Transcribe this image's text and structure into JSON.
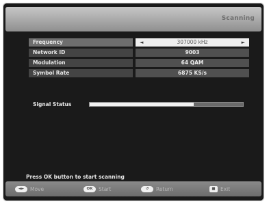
{
  "header": {
    "title": "Scanning"
  },
  "fields": [
    {
      "label": "Frequency",
      "value": "307000 kHz",
      "selected": true
    },
    {
      "label": "Network ID",
      "value": "9003",
      "selected": false
    },
    {
      "label": "Modulation",
      "value": "64 QAM",
      "selected": false
    },
    {
      "label": "Symbol Rate",
      "value": "6875 KS/s",
      "selected": false
    }
  ],
  "signal": {
    "label": "Signal Status",
    "level": 0.68
  },
  "hint": "Press OK button to start scanning",
  "footer": {
    "move": {
      "key": "◄►",
      "label": "Move",
      "icon": "left-right-arrows-icon"
    },
    "start": {
      "key": "OK",
      "label": "Start",
      "icon": "ok-key-icon"
    },
    "return": {
      "key": "↺",
      "label": "Return",
      "icon": "return-key-icon"
    },
    "exit": {
      "key": "■",
      "label": "Exit",
      "icon": "exit-key-icon"
    }
  },
  "colors": {
    "panel": "#1a1a1a",
    "header": "#a9a9a9",
    "selected_value_bg": "#efefef",
    "signal_fill": "#f2f2f2"
  }
}
